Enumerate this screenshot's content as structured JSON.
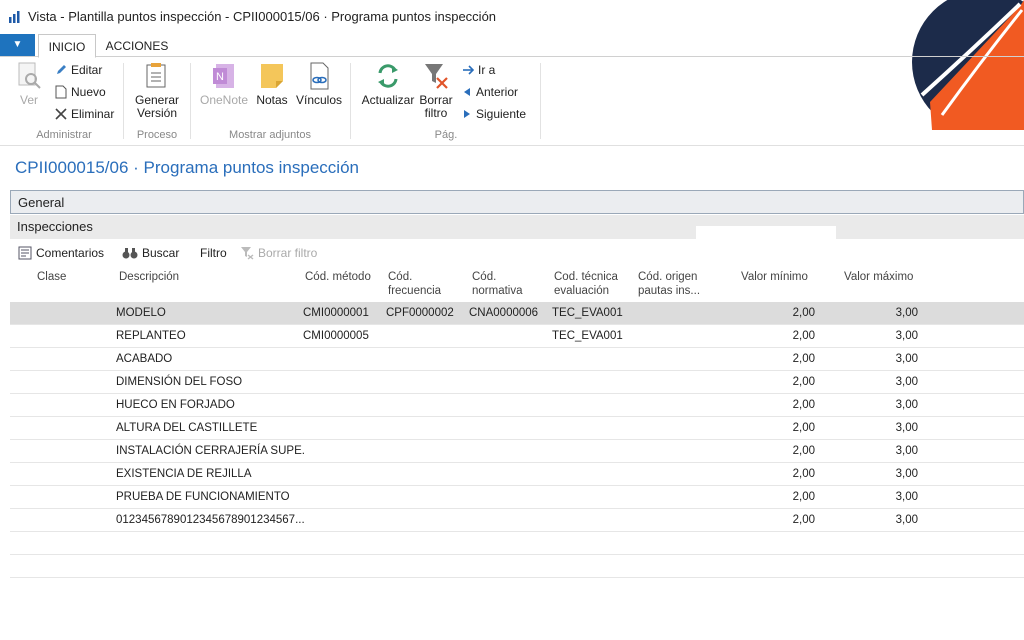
{
  "window": {
    "title": "Vista - Plantilla puntos inspección - CPII000015/06 · Programa puntos inspección"
  },
  "ribbon": {
    "tabs": [
      "INICIO",
      "ACCIONES"
    ],
    "groups": {
      "administrar": {
        "label": "Administrar",
        "ver": "Ver",
        "editar": "Editar",
        "nuevo": "Nuevo",
        "eliminar": "Eliminar"
      },
      "proceso": {
        "label": "Proceso",
        "generar_l1": "Generar",
        "generar_l2": "Versión"
      },
      "adjuntos": {
        "label": "Mostrar adjuntos",
        "onenote": "OneNote",
        "notas": "Notas",
        "vinculos": "Vínculos"
      },
      "pag": {
        "label": "Pág.",
        "actualizar": "Actualizar",
        "borrar_l1": "Borrar",
        "borrar_l2": "filtro",
        "ira": "Ir a",
        "anterior": "Anterior",
        "siguiente": "Siguiente"
      }
    }
  },
  "page": {
    "title": "CPII000015/06 · Programa puntos inspección"
  },
  "fasttabs": {
    "general": "General",
    "inspecciones": "Inspecciones"
  },
  "subtoolbar": {
    "comentarios": "Comentarios",
    "buscar": "Buscar",
    "filtro": "Filtro",
    "borrar_filtro": "Borrar filtro"
  },
  "table": {
    "headers": {
      "clase": "Clase",
      "descripcion": "Descripción",
      "metodo": "Cód. método",
      "frecuencia_l1": "Cód.",
      "frecuencia_l2": "frecuencia",
      "normativa_l1": "Cód.",
      "normativa_l2": "normativa",
      "tecnica_l1": "Cod. técnica",
      "tecnica_l2": "evaluación",
      "origen_l1": "Cód. origen",
      "origen_l2": "pautas ins...",
      "minimo": "Valor mínimo",
      "maximo": "Valor máximo"
    },
    "rows": [
      {
        "descripcion": "MODELO",
        "metodo": "CMI0000001",
        "frecuencia": "CPF0000002",
        "normativa": "CNA0000006",
        "tecnica": "TEC_EVA001",
        "minimo": "2,00",
        "maximo": "3,00"
      },
      {
        "descripcion": "REPLANTEO",
        "metodo": "CMI0000005",
        "frecuencia": "",
        "normativa": "",
        "tecnica": "TEC_EVA001",
        "minimo": "2,00",
        "maximo": "3,00"
      },
      {
        "descripcion": "ACABADO",
        "metodo": "",
        "frecuencia": "",
        "normativa": "",
        "tecnica": "",
        "minimo": "2,00",
        "maximo": "3,00"
      },
      {
        "descripcion": "DIMENSIÓN DEL FOSO",
        "metodo": "",
        "frecuencia": "",
        "normativa": "",
        "tecnica": "",
        "minimo": "2,00",
        "maximo": "3,00"
      },
      {
        "descripcion": "HUECO EN FORJADO",
        "metodo": "",
        "frecuencia": "",
        "normativa": "",
        "tecnica": "",
        "minimo": "2,00",
        "maximo": "3,00"
      },
      {
        "descripcion": "ALTURA DEL CASTILLETE",
        "metodo": "",
        "frecuencia": "",
        "normativa": "",
        "tecnica": "",
        "minimo": "2,00",
        "maximo": "3,00"
      },
      {
        "descripcion": "INSTALACIÓN CERRAJERÍA SUPE...",
        "metodo": "",
        "frecuencia": "",
        "normativa": "",
        "tecnica": "",
        "minimo": "2,00",
        "maximo": "3,00"
      },
      {
        "descripcion": "EXISTENCIA DE REJILLA",
        "metodo": "",
        "frecuencia": "",
        "normativa": "",
        "tecnica": "",
        "minimo": "2,00",
        "maximo": "3,00"
      },
      {
        "descripcion": "PRUEBA DE FUNCIONAMIENTO",
        "metodo": "",
        "frecuencia": "",
        "normativa": "",
        "tecnica": "",
        "minimo": "2,00",
        "maximo": "3,00"
      },
      {
        "descripcion": "0123456789012345678901234567...",
        "metodo": "",
        "frecuencia": "",
        "normativa": "",
        "tecnica": "",
        "minimo": "2,00",
        "maximo": "3,00"
      }
    ]
  },
  "colors": {
    "accent": "#2a6ebb",
    "file_button": "#1e73be",
    "logo_navy": "#1c2b4a",
    "logo_orange": "#f15a22"
  }
}
